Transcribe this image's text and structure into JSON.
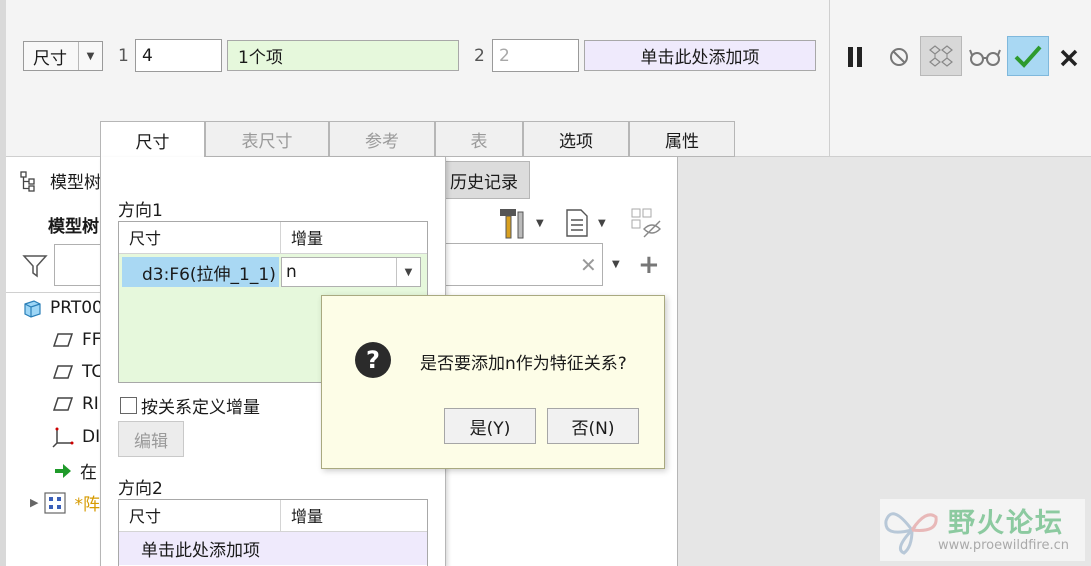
{
  "ribbon": {
    "type_select": "尺寸",
    "dir1_index": "1",
    "dir1_count": "4",
    "dir1_collector": "1个项",
    "dir2_index": "2",
    "dir2_count": "2",
    "dir2_collector": "单击此处添加项"
  },
  "tabs": [
    "尺寸",
    "表尺寸",
    "参考",
    "表",
    "选项",
    "属性"
  ],
  "tree": {
    "tab_model": "模型树",
    "tab_history": "历史记录",
    "header": "模型树",
    "items": [
      "PRT00",
      "FF",
      "TC",
      "RI",
      "DI",
      "在",
      "*阵"
    ]
  },
  "dim_panel": {
    "dir1_title": "方向1",
    "col_dimension": "尺寸",
    "col_increment": "增量",
    "row_dimension": "d3:F6(拉伸_1_1)",
    "row_increment": "n",
    "checkbox_label": "按关系定义增量",
    "edit_button": "编辑",
    "dir2_title": "方向2",
    "dir2_col_dimension": "尺寸",
    "dir2_col_increment": "增量",
    "dir2_placeholder": "单击此处添加项"
  },
  "dialog": {
    "message": "是否要添加n作为特征关系?",
    "yes": "是(Y)",
    "no": "否(N)"
  },
  "watermark": {
    "title": "野火论坛",
    "url": "www.proewildfire.cn"
  },
  "colors": {
    "accept_green": "#2e9a2e",
    "accept_bg": "#a9d8f3",
    "collector_green": "#e6f8dc",
    "collector_lavender": "#efeafc",
    "dialog_bg": "#fdfde7"
  }
}
